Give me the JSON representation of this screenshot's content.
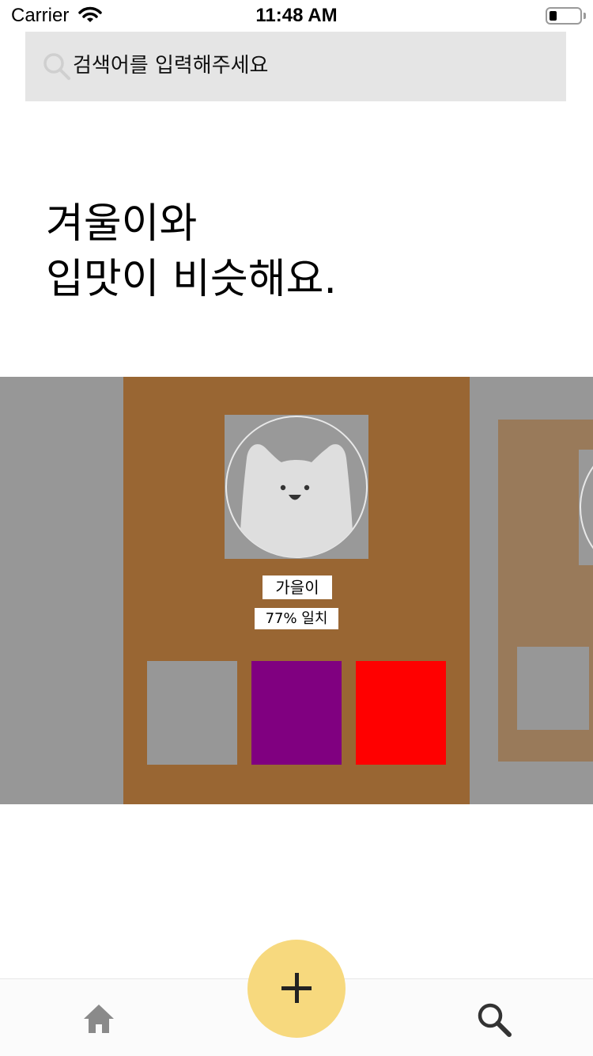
{
  "status_bar": {
    "carrier": "Carrier",
    "time": "11:48 AM",
    "battery_level": 0.25
  },
  "search": {
    "placeholder": "검색어를 입력해주세요",
    "icon": "search-icon"
  },
  "headline": {
    "line1": "겨울이와",
    "line2": "입맛이 비슷해요."
  },
  "carousel": {
    "current": {
      "name": "가을이",
      "match": "77% 일치",
      "background_color": "#996633",
      "swatches": [
        "#979797",
        "#800080",
        "#ff0000"
      ]
    },
    "next": {
      "background_color": "#997a5a"
    }
  },
  "tab_bar": {
    "items": [
      {
        "icon": "home-icon"
      },
      {
        "icon": "search-icon"
      }
    ],
    "fab_icon": "plus-icon",
    "fab_color": "#f7d97e"
  }
}
